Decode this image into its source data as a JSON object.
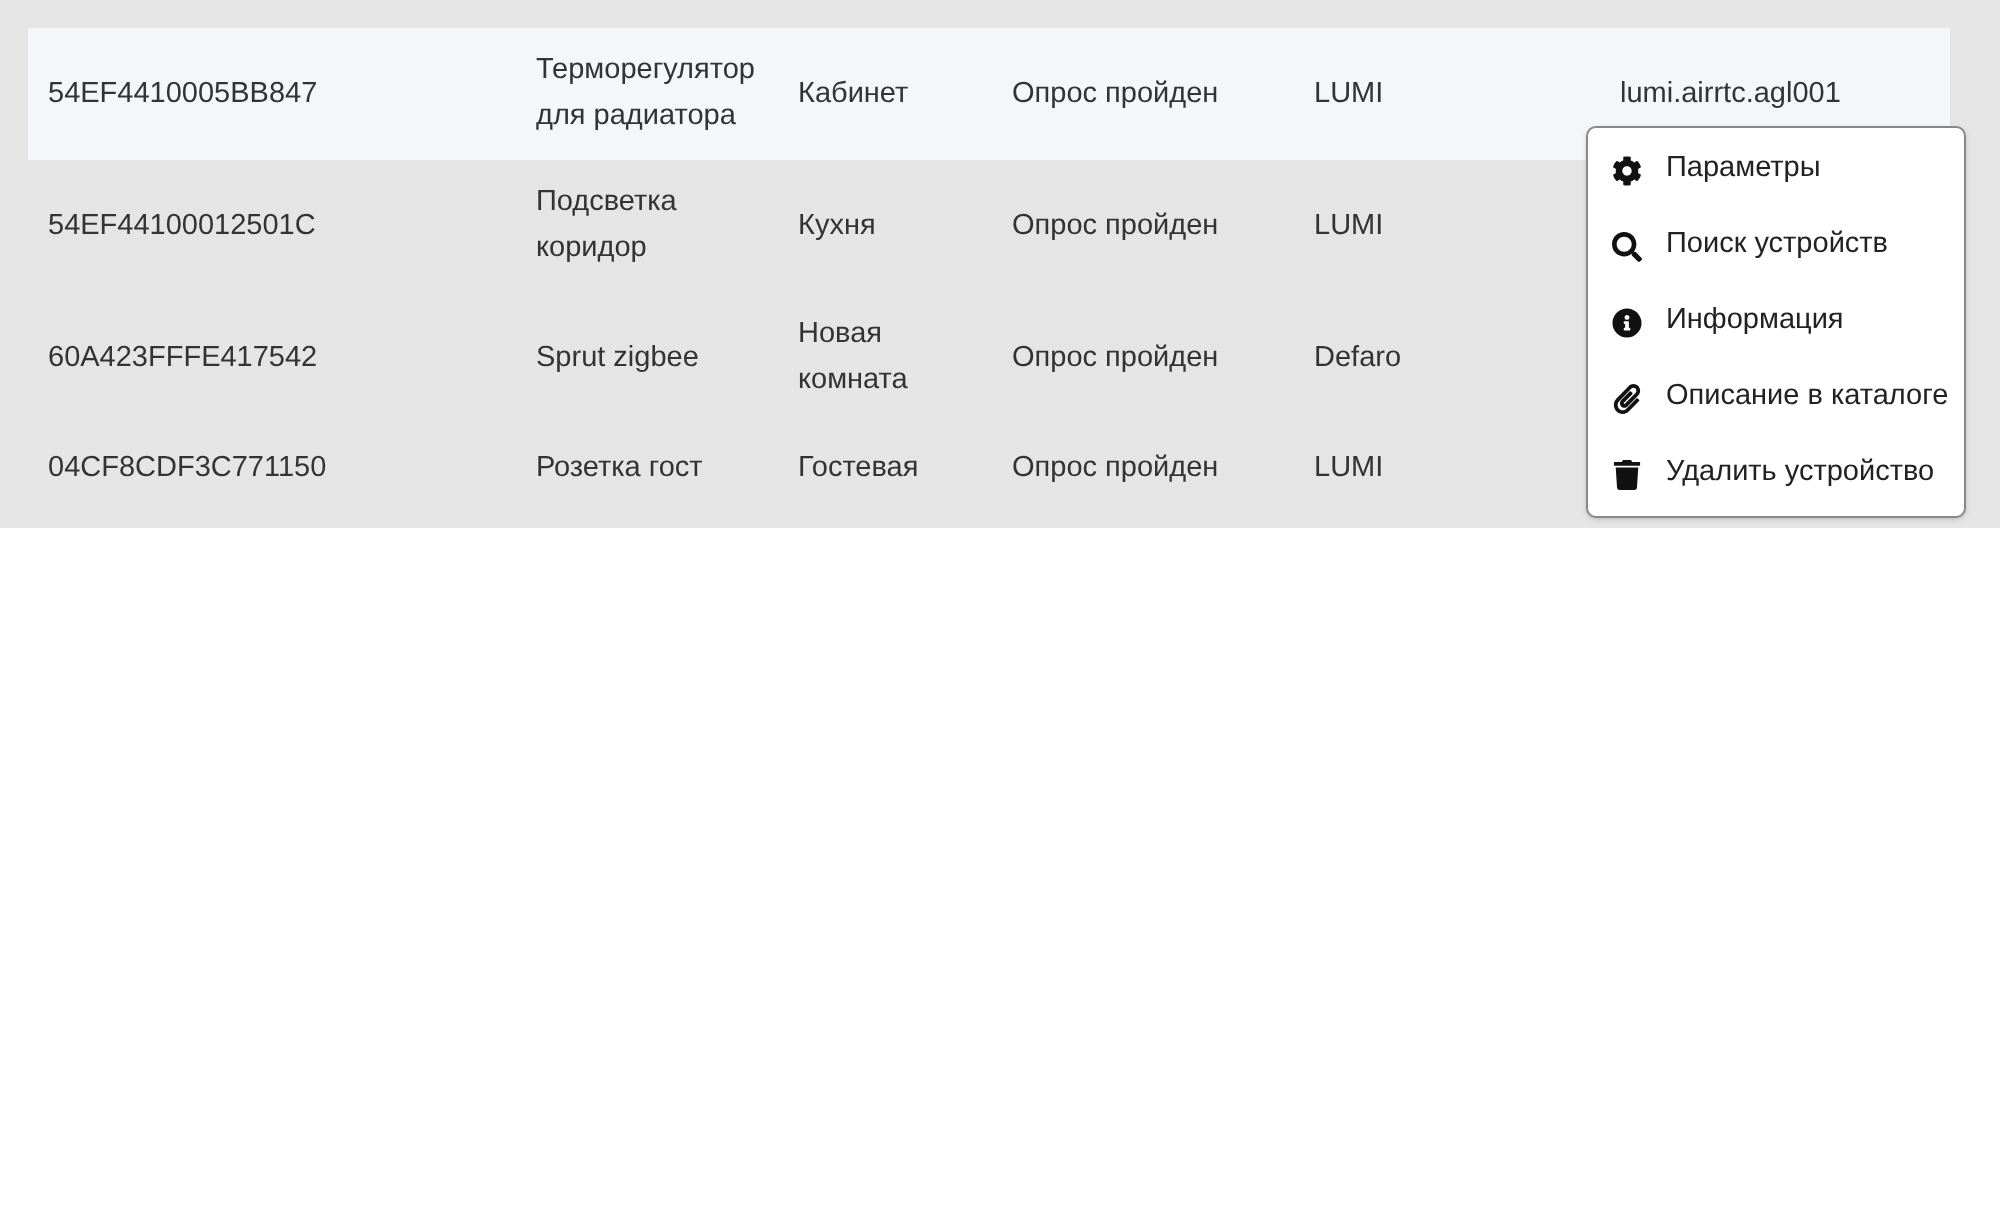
{
  "table": {
    "rows": [
      {
        "selected": true,
        "cells": [
          "54EF4410005BB847",
          "Терморегулятор для радиатора",
          "Кабинет",
          "Опрос пройден",
          "LUMI",
          "lumi.airrtc.agl001"
        ]
      },
      {
        "selected": false,
        "cells": [
          "54EF44100012501C",
          "Подсветка коридор",
          "Кухня",
          "Опрос пройден",
          "LUMI"
        ]
      },
      {
        "selected": false,
        "cells": [
          "60A423FFFE417542",
          "Sprut zigbee",
          "Новая комната",
          "Опрос пройден",
          "Defaro"
        ]
      },
      {
        "selected": false,
        "cells": [
          "04CF8CDF3C771150",
          "Розетка гост",
          "Гостевая",
          "Опрос пройден",
          "LUMI"
        ]
      }
    ]
  },
  "context_menu": {
    "items": [
      {
        "kind": "settings",
        "label": "Параметры"
      },
      {
        "kind": "search",
        "label": "Поиск устройств"
      },
      {
        "kind": "info",
        "label": "Информация"
      },
      {
        "kind": "attachment",
        "label": "Описание в каталоге"
      },
      {
        "kind": "delete",
        "label": "Удалить устройство"
      }
    ]
  }
}
